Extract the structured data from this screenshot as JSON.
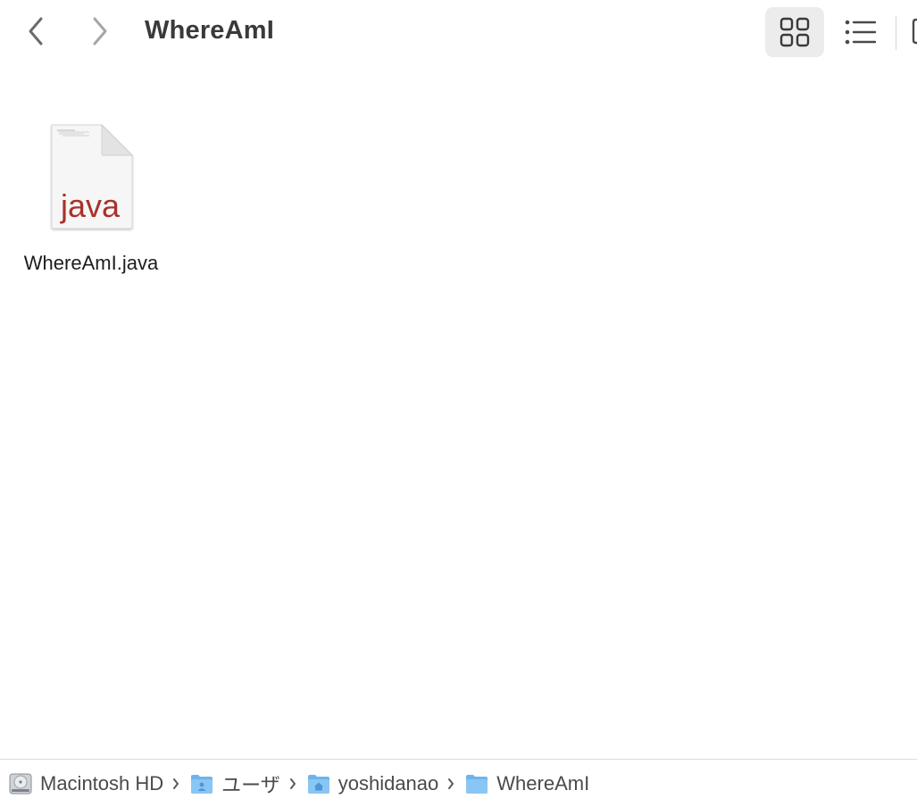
{
  "window": {
    "title": "WhereAmI"
  },
  "toolbar": {
    "back_icon": "chevron-left-icon",
    "forward_icon": "chevron-right-icon",
    "grid_view_icon": "grid-view-icon",
    "list_view_icon": "list-view-icon",
    "active_view": "grid"
  },
  "files": [
    {
      "name": "WhereAmI.java",
      "icon_label": "java",
      "icon": "java-document-icon"
    }
  ],
  "pathbar": {
    "items": [
      {
        "label": "Macintosh HD",
        "icon": "hard-drive-icon"
      },
      {
        "label": "ユーザ",
        "icon": "users-folder-icon"
      },
      {
        "label": "yoshidanao",
        "icon": "home-folder-icon"
      },
      {
        "label": "WhereAmI",
        "icon": "folder-icon"
      }
    ]
  },
  "colors": {
    "java_label": "#a8322b",
    "folder_blue": "#6cb4ee",
    "selected_view_bg": "#ececec"
  }
}
